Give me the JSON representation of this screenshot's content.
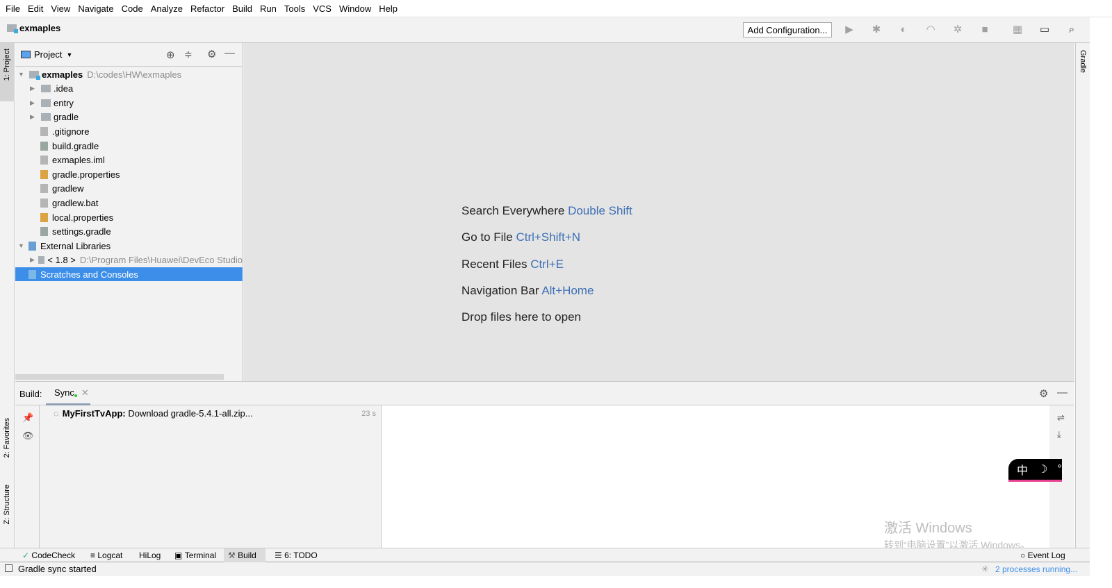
{
  "menu": [
    "File",
    "Edit",
    "View",
    "Navigate",
    "Code",
    "Analyze",
    "Refactor",
    "Build",
    "Run",
    "Tools",
    "VCS",
    "Window",
    "Help"
  ],
  "toolbar": {
    "project_name": "exmaples",
    "add_configuration": "Add Configuration..."
  },
  "left_stripe": {
    "project": "1: Project",
    "favorites": "2: Favorites",
    "structure": "Z: Structure"
  },
  "right_stripe": {
    "gradle": "Gradle"
  },
  "project_panel": {
    "view": "Project",
    "tree": [
      {
        "label": "exmaples",
        "path": "D:\\codes\\HW\\exmaples",
        "level": 0,
        "expanded": true,
        "bold": true,
        "icon": "module-folder"
      },
      {
        "label": ".idea",
        "level": 1,
        "expanded": false,
        "icon": "folder"
      },
      {
        "label": "entry",
        "level": 1,
        "expanded": false,
        "icon": "folder"
      },
      {
        "label": "gradle",
        "level": 1,
        "expanded": false,
        "icon": "folder"
      },
      {
        "label": ".gitignore",
        "level": 1,
        "icon": "file"
      },
      {
        "label": "build.gradle",
        "level": 1,
        "icon": "gradle"
      },
      {
        "label": "exmaples.iml",
        "level": 1,
        "icon": "file"
      },
      {
        "label": "gradle.properties",
        "level": 1,
        "icon": "properties"
      },
      {
        "label": "gradlew",
        "level": 1,
        "icon": "file"
      },
      {
        "label": "gradlew.bat",
        "level": 1,
        "icon": "file"
      },
      {
        "label": "local.properties",
        "level": 1,
        "icon": "properties"
      },
      {
        "label": "settings.gradle",
        "level": 1,
        "icon": "gradle"
      },
      {
        "label": "External Libraries",
        "level": 0,
        "expanded": true,
        "icon": "library"
      },
      {
        "label": "< 1.8 >",
        "path": "D:\\Program Files\\Huawei\\DevEco Studio",
        "level": 1,
        "expanded": false,
        "icon": "folder"
      },
      {
        "label": "Scratches and Consoles",
        "level": 0,
        "selected": true,
        "icon": "scratches"
      }
    ]
  },
  "editor_hints": [
    {
      "text": "Search Everywhere",
      "key": "Double Shift"
    },
    {
      "text": "Go to File",
      "key": "Ctrl+Shift+N"
    },
    {
      "text": "Recent Files",
      "key": "Ctrl+E"
    },
    {
      "text": "Navigation Bar",
      "key": "Alt+Home"
    },
    {
      "text": "Drop files here to open",
      "key": ""
    }
  ],
  "build": {
    "label": "Build:",
    "tab": "Sync",
    "task_name": "MyFirstTvApp:",
    "task_text": "Download gradle-5.4.1-all.zip...",
    "elapsed": "23 s"
  },
  "bottom_tabs": [
    "CodeCheck",
    "Logcat",
    "HiLog",
    "Terminal",
    "Build",
    "6: TODO"
  ],
  "event_log": "Event Log",
  "status": {
    "message": "Gradle sync started",
    "processes": "2 processes running..."
  },
  "ime": {
    "lang": "中",
    "mode": "☽",
    "punct": "°,"
  },
  "watermark": {
    "title": "激活 Windows",
    "subtitle": "转到“电脑设置”以激活 Windows。"
  },
  "colors": {
    "accent": "#3d8ee9",
    "shortcut": "#3d6fb4",
    "selection": "#3d8ee9"
  }
}
